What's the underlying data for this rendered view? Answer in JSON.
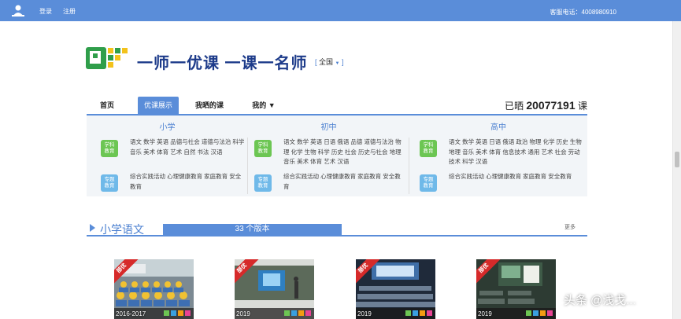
{
  "topbar": {
    "login": "登录",
    "register": "注册",
    "phone": "客服电话：4008980910"
  },
  "header": {
    "slogan": "一师一优课  一课一名师",
    "region": "全国"
  },
  "nav": {
    "tabs": [
      "首页",
      "优课展示",
      "我晒的课",
      "我的"
    ],
    "active_tab": "优课展示",
    "counter_prefix": "已晒",
    "counter_value": "20077191",
    "counter_suffix": "课"
  },
  "categories": [
    {
      "title": "小学",
      "subject_badge": "学科教育",
      "subjects": "语文 数学 英语 品德与社会 道德与法治 科学 音乐 美术 体育 艺术 自然 书法 汉语",
      "topic_badge": "专题教育",
      "topics": "综合实践活动 心理健康教育 家庭教育 安全教育"
    },
    {
      "title": "初中",
      "subject_badge": "学科教育",
      "subjects": "语文 数学 英语 日语 俄语 品德 道德与法治 物理 化学 生物 科学 历史 社会 历史与社会 地理 音乐 美术 体育 艺术 汉语",
      "topic_badge": "专题教育",
      "topics": "综合实践活动 心理健康教育 家庭教育 安全教育"
    },
    {
      "title": "高中",
      "subject_badge": "学科教育",
      "subjects": "语文 数学 英语 日语 俄语 政治 物理 化学 历史 生物 地理 音乐 美术 体育 信息技术 通用 艺术 社会 劳动技术 科学 汉语",
      "topic_badge": "专题教育",
      "topics": "综合实践活动 心理健康教育 家庭教育 安全教育"
    }
  ],
  "section": {
    "title": "小学语文",
    "versions": "33 个版本",
    "more": "更多"
  },
  "thumbnails": [
    {
      "ribbon": "部优",
      "year": "2016-2017"
    },
    {
      "ribbon": "部优",
      "year": "2019"
    },
    {
      "ribbon": "部优",
      "year": "2019"
    },
    {
      "ribbon": "部优",
      "year": "2019"
    }
  ],
  "watermark": "头条 @浅戈...",
  "colors": {
    "brand_blue": "#5a8dd9",
    "ribbon_red": "#d62a2a",
    "subject_green": "#6cc653",
    "topic_blue": "#6fb9e9"
  }
}
